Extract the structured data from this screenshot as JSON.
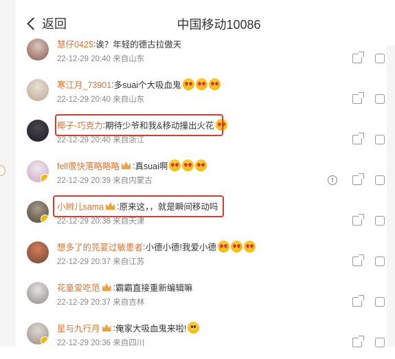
{
  "header": {
    "back_label": "返回",
    "title": "中国移动10086"
  },
  "comments": [
    {
      "user": "慧仔0425",
      "text": "诶？年轻的德古拉傲天",
      "time": "22-12-29 20:40",
      "location": "来自山东",
      "emoji": [],
      "crown": false,
      "verified": false,
      "report": false,
      "avatar_colors": [
        "#d9c7c0",
        "#8a5a4e"
      ]
    },
    {
      "user": "寒江月_73901",
      "text": "多suai个大吸血鬼",
      "time": "22-12-29 20:40",
      "location": "来自山东",
      "emoji": [
        "heart-eyes",
        "heart-eyes",
        "heart-eyes"
      ],
      "crown": false,
      "verified": false,
      "report": false,
      "avatar_colors": [
        "#e9e2d8",
        "#b9a58e"
      ]
    },
    {
      "user": "椰子-巧克力",
      "text": "期待少爷和我&移动撞出火花",
      "time": "22-12-29 20:40",
      "location": "来自浙江",
      "emoji": [
        "shy"
      ],
      "crown": false,
      "verified": false,
      "report": false,
      "avatar_colors": [
        "#4a4750",
        "#1e1c22"
      ]
    },
    {
      "user": "fell很快落略略略",
      "text": "真suai啊",
      "time": "22-12-29 20:39",
      "location": "来自内蒙古",
      "emoji": [
        "heart-eyes",
        "heart-eyes",
        "heart-eyes"
      ],
      "crown": true,
      "verified": true,
      "report": true,
      "avatar_colors": [
        "#efe8ee",
        "#c9a6c4"
      ]
    },
    {
      "user": "小辫儿sama",
      "text": "原来这，，就是瞬间移动吗",
      "time": "22-12-29 20:38",
      "location": "来自天津",
      "emoji": [],
      "crown": true,
      "verified": true,
      "report": false,
      "avatar_colors": [
        "#a89c8a",
        "#4d4538"
      ]
    },
    {
      "user": "想多了的芫荽过敏患者",
      "text": "小德小德!我爱小德",
      "time": "22-12-29 20:37",
      "location": "来自江苏",
      "emoji": [
        "love",
        "love",
        "love"
      ],
      "crown": false,
      "verified": false,
      "report": false,
      "avatar_colors": [
        "#d87a55",
        "#6b4a3a"
      ]
    },
    {
      "user": "花童爱吃范",
      "text": "霸霸直接重新编辑嘛",
      "time": "22-12-29 20:37",
      "location": "来自吉林",
      "emoji": [],
      "crown": true,
      "verified": false,
      "report": false,
      "avatar_colors": [
        "#e7e3de",
        "#8c8c8c"
      ]
    },
    {
      "user": "星与九行月",
      "text": "俺家大吸血鬼来啦!",
      "time": "22-12-29 20:36",
      "location": "来自四川",
      "emoji": [
        "surprised"
      ],
      "crown": true,
      "verified": true,
      "report": false,
      "avatar_colors": [
        "#dfd8d2",
        "#9a8f86"
      ]
    }
  ]
}
